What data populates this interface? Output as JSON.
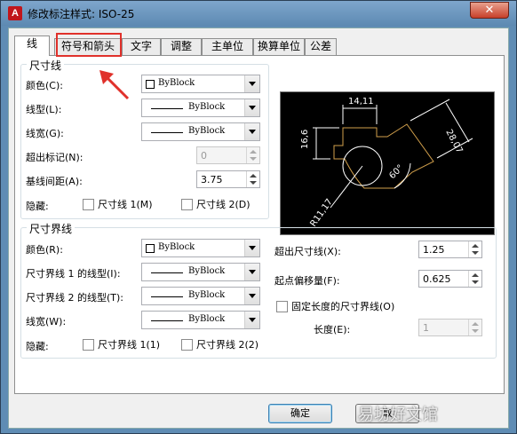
{
  "window": {
    "title": "修改标注样式: ISO-25",
    "app_icon_letter": "A",
    "close_glyph": "✕"
  },
  "tabs": [
    {
      "label": "线",
      "active": true
    },
    {
      "label": "符号和箭头",
      "active": false
    },
    {
      "label": "文字",
      "active": false
    },
    {
      "label": "调整",
      "active": false
    },
    {
      "label": "主单位",
      "active": false
    },
    {
      "label": "换算单位",
      "active": false
    },
    {
      "label": "公差",
      "active": false
    }
  ],
  "dim_lines": {
    "group_label": "尺寸线",
    "color_label": "颜色(C):",
    "color_value": "ByBlock",
    "linetype_label": "线型(L):",
    "linetype_value": "ByBlock",
    "lineweight_label": "线宽(G):",
    "lineweight_value": "ByBlock",
    "extend_ticks_label": "超出标记(N):",
    "extend_ticks_value": "0",
    "baseline_spacing_label": "基线间距(A):",
    "baseline_spacing_value": "3.75",
    "suppress_label": "隐藏:",
    "suppress_1": "尺寸线 1(M)",
    "suppress_2": "尺寸线 2(D)"
  },
  "ext_lines": {
    "group_label": "尺寸界线",
    "color_label": "颜色(R):",
    "color_value": "ByBlock",
    "linetype1_label": "尺寸界线 1 的线型(I):",
    "linetype1_value": "ByBlock",
    "linetype2_label": "尺寸界线 2 的线型(T):",
    "linetype2_value": "ByBlock",
    "lineweight_label": "线宽(W):",
    "lineweight_value": "ByBlock",
    "suppress_label": "隐藏:",
    "suppress_1": "尺寸界线 1(1)",
    "suppress_2": "尺寸界线 2(2)",
    "extend_beyond_label": "超出尺寸线(X):",
    "extend_beyond_value": "1.25",
    "offset_label": "起点偏移量(F):",
    "offset_value": "0.625",
    "fixed_length_label": "固定长度的尺寸界线(O)",
    "length_label": "长度(E):",
    "length_value": "1"
  },
  "preview": {
    "dim_top": "14,11",
    "dim_left": "16,6",
    "dim_right": "28,07",
    "dim_angle": "60°",
    "dim_radius": "R11,17"
  },
  "buttons": {
    "ok": "确定",
    "cancel": "取"
  },
  "watermark": "易坊好文馆"
}
